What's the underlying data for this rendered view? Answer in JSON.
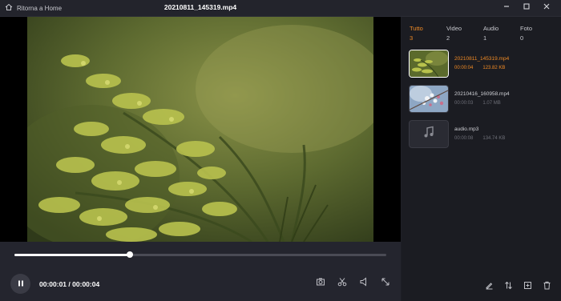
{
  "titlebar": {
    "back_label": "Ritorna a Home",
    "file_title": "20210811_145319.mp4",
    "icons": [
      "home-icon",
      "minimize-icon",
      "maximize-icon",
      "close-icon"
    ]
  },
  "player": {
    "progress_fraction": 0.31,
    "current_time": "00:00:01",
    "separator": "/",
    "total_time": "00:00:04",
    "controls": [
      "screenshot-icon",
      "cut-icon",
      "volume-icon",
      "fullscreen-icon"
    ]
  },
  "sidebar": {
    "tabs": [
      {
        "label": "Tutto",
        "count": "3",
        "active": true
      },
      {
        "label": "Video",
        "count": "2",
        "active": false
      },
      {
        "label": "Audio",
        "count": "1",
        "active": false
      },
      {
        "label": "Foto",
        "count": "0",
        "active": false
      }
    ],
    "files": [
      {
        "name": "20210811_145319.mp4",
        "duration": "00:00:04",
        "size": "123.82 KB",
        "active": true
      },
      {
        "name": "20210416_160958.mp4",
        "duration": "00:00:03",
        "size": "1.07 MB",
        "active": false
      },
      {
        "name": "audio.mp3",
        "duration": "00:00:08",
        "size": "134.74 KB",
        "active": false
      }
    ],
    "bottom_icons": [
      "edit-icon",
      "sort-icon",
      "add-file-icon",
      "delete-icon"
    ]
  },
  "colors": {
    "accent": "#f08a24",
    "background": "#1e1f26",
    "sidebar": "#1b1c22",
    "controls": "#24252e"
  }
}
